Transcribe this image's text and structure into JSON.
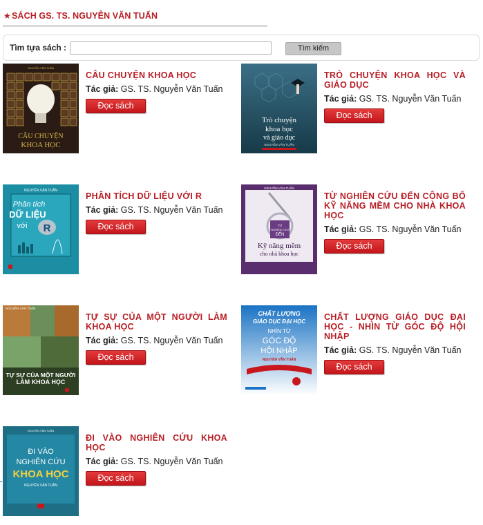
{
  "section": {
    "star": "★",
    "title": "SÁCH GS. TS. NGUYỄN VĂN TUẤN"
  },
  "search": {
    "label": "Tìm tựa sách :",
    "value": "",
    "placeholder": "",
    "button": "Tìm kiếm"
  },
  "common": {
    "author_label": "Tác giả:",
    "read_button": "Đọc sách"
  },
  "books": [
    {
      "title": "CÂU CHUYỆN KHOA HỌC",
      "author": "GS. TS. Nguyễn Văn Tuấn",
      "cover": {
        "top_text": "NGUYỄN VĂN TUẤN",
        "lines": [
          "CÂU CHUYỆN",
          "KHOA HỌC"
        ],
        "bg": "#2a1c14",
        "accent": "#d8b44a"
      }
    },
    {
      "title": "TRÒ CHUYỆN KHOA HỌC VÀ GIÁO DỤC",
      "author": "GS. TS. Nguyễn Văn Tuấn",
      "cover": {
        "lines": [
          "Trò chuyện",
          "khoa học",
          "và giáo dục"
        ],
        "author": "NGUYỄN VĂN TUẤN",
        "bg": "#1f4a5a",
        "accent": "#cfe3ea"
      }
    },
    {
      "title": "PHÂN TÍCH DỮ LIỆU VỚI R",
      "author": "GS. TS. Nguyễn Văn Tuấn",
      "cover": {
        "top_text": "NGUYỄN VĂN TUẤN",
        "lines": [
          "Phân tích",
          "DỮ LIỆU",
          "với"
        ],
        "bg": "#1b8ea3",
        "accent": "#ffffff"
      }
    },
    {
      "title": "TỪ NGHIÊN CỨU ĐẾN CÔNG BỐ KỸ NĂNG MỀM CHO NHÀ KHOA HỌC",
      "author": "GS. TS. Nguyễn Văn Tuấn",
      "cover": {
        "top_text": "NGUYỄN VĂN TUẤN",
        "lines": [
          "Kỹ năng mềm",
          "cho nhà khoa học"
        ],
        "bg": "#5a2e6e",
        "accent": "#ffffff"
      }
    },
    {
      "title": "TỰ SỰ CỦA MỘT NGƯỜI LÀM KHOA HỌC",
      "author": "GS. TS. Nguyễn Văn Tuấn",
      "cover": {
        "top_text": "NGUYỄN VĂN TUẤN",
        "lines": [
          "TỰ SỰ CỦA MỘT NGƯỜI",
          "LÀM KHOA HỌC"
        ],
        "bg": "#3a4a28",
        "accent": "#ffffff"
      }
    },
    {
      "title": "CHẤT LƯỢNG GIÁO DỤC ĐẠI HỌC - NHÌN TỪ GÓC ĐỘ HỘI NHẬP",
      "author": "GS. TS. Nguyễn Văn Tuấn",
      "cover": {
        "lines": [
          "CHẤT LƯỢNG",
          "GIÁO DỤC ĐẠI HỌC",
          "NHÌN TỪ",
          "GÓC ĐỘ",
          "HỘI NHẬP"
        ],
        "author": "NGUYỄN VĂN TUẤN",
        "bg": "#1a73c4",
        "accent": "#ffffff"
      }
    },
    {
      "title": "ĐI VÀO NGHIÊN CỨU KHOA HỌC",
      "author": "GS. TS. Nguyễn Văn Tuấn",
      "cover": {
        "lines": [
          "ĐI VÀO",
          "NGHIÊN CỨU",
          "KHOA HỌC"
        ],
        "author": "NGUYỄN VĂN TUẤN",
        "bg": "#1e6e86",
        "accent": "#f4d03f"
      }
    }
  ]
}
